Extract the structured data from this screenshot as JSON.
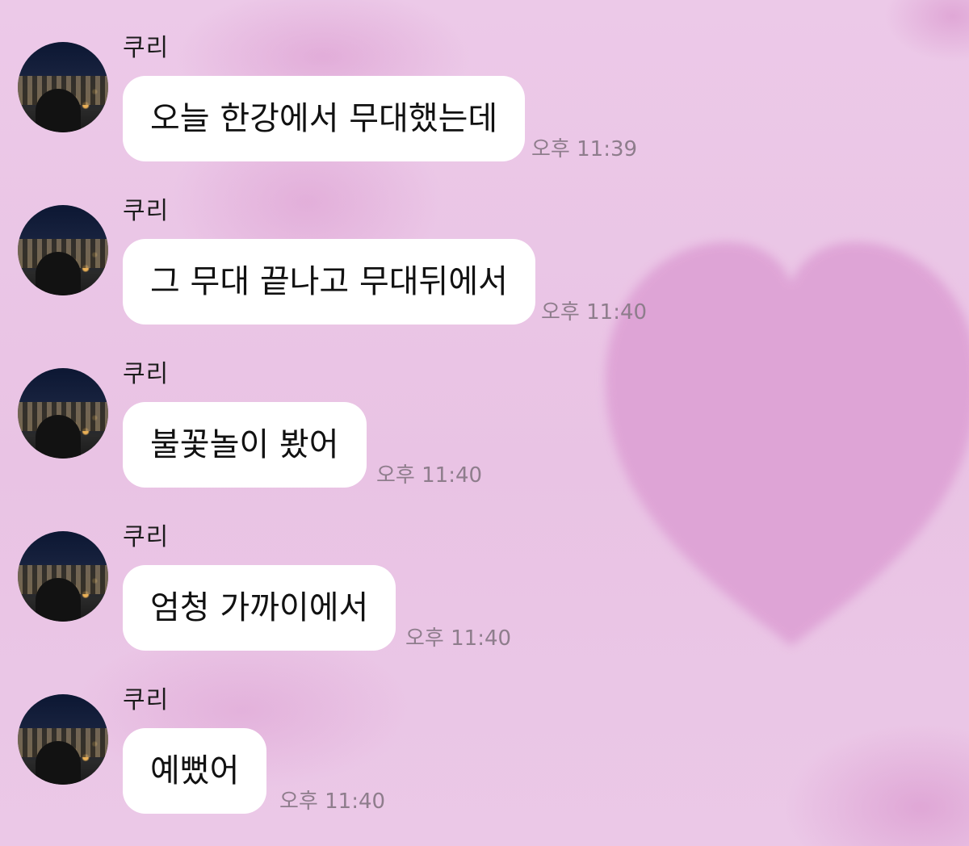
{
  "theme": {
    "background": "#eac7e6",
    "bubble_color": "#ffffff",
    "text_color": "#111111",
    "time_color": "#8e7d8c"
  },
  "messages": [
    {
      "sender": "쿠리",
      "text": "오늘 한강에서 무대했는데",
      "time": "오후 11:39"
    },
    {
      "sender": "쿠리",
      "text": "그 무대 끝나고 무대뒤에서",
      "time": "오후 11:40"
    },
    {
      "sender": "쿠리",
      "text": "불꽃놀이 봤어",
      "time": "오후 11:40"
    },
    {
      "sender": "쿠리",
      "text": "엄청 가까이에서",
      "time": "오후 11:40"
    },
    {
      "sender": "쿠리",
      "text": "예뻤어",
      "time": "오후 11:40"
    }
  ]
}
